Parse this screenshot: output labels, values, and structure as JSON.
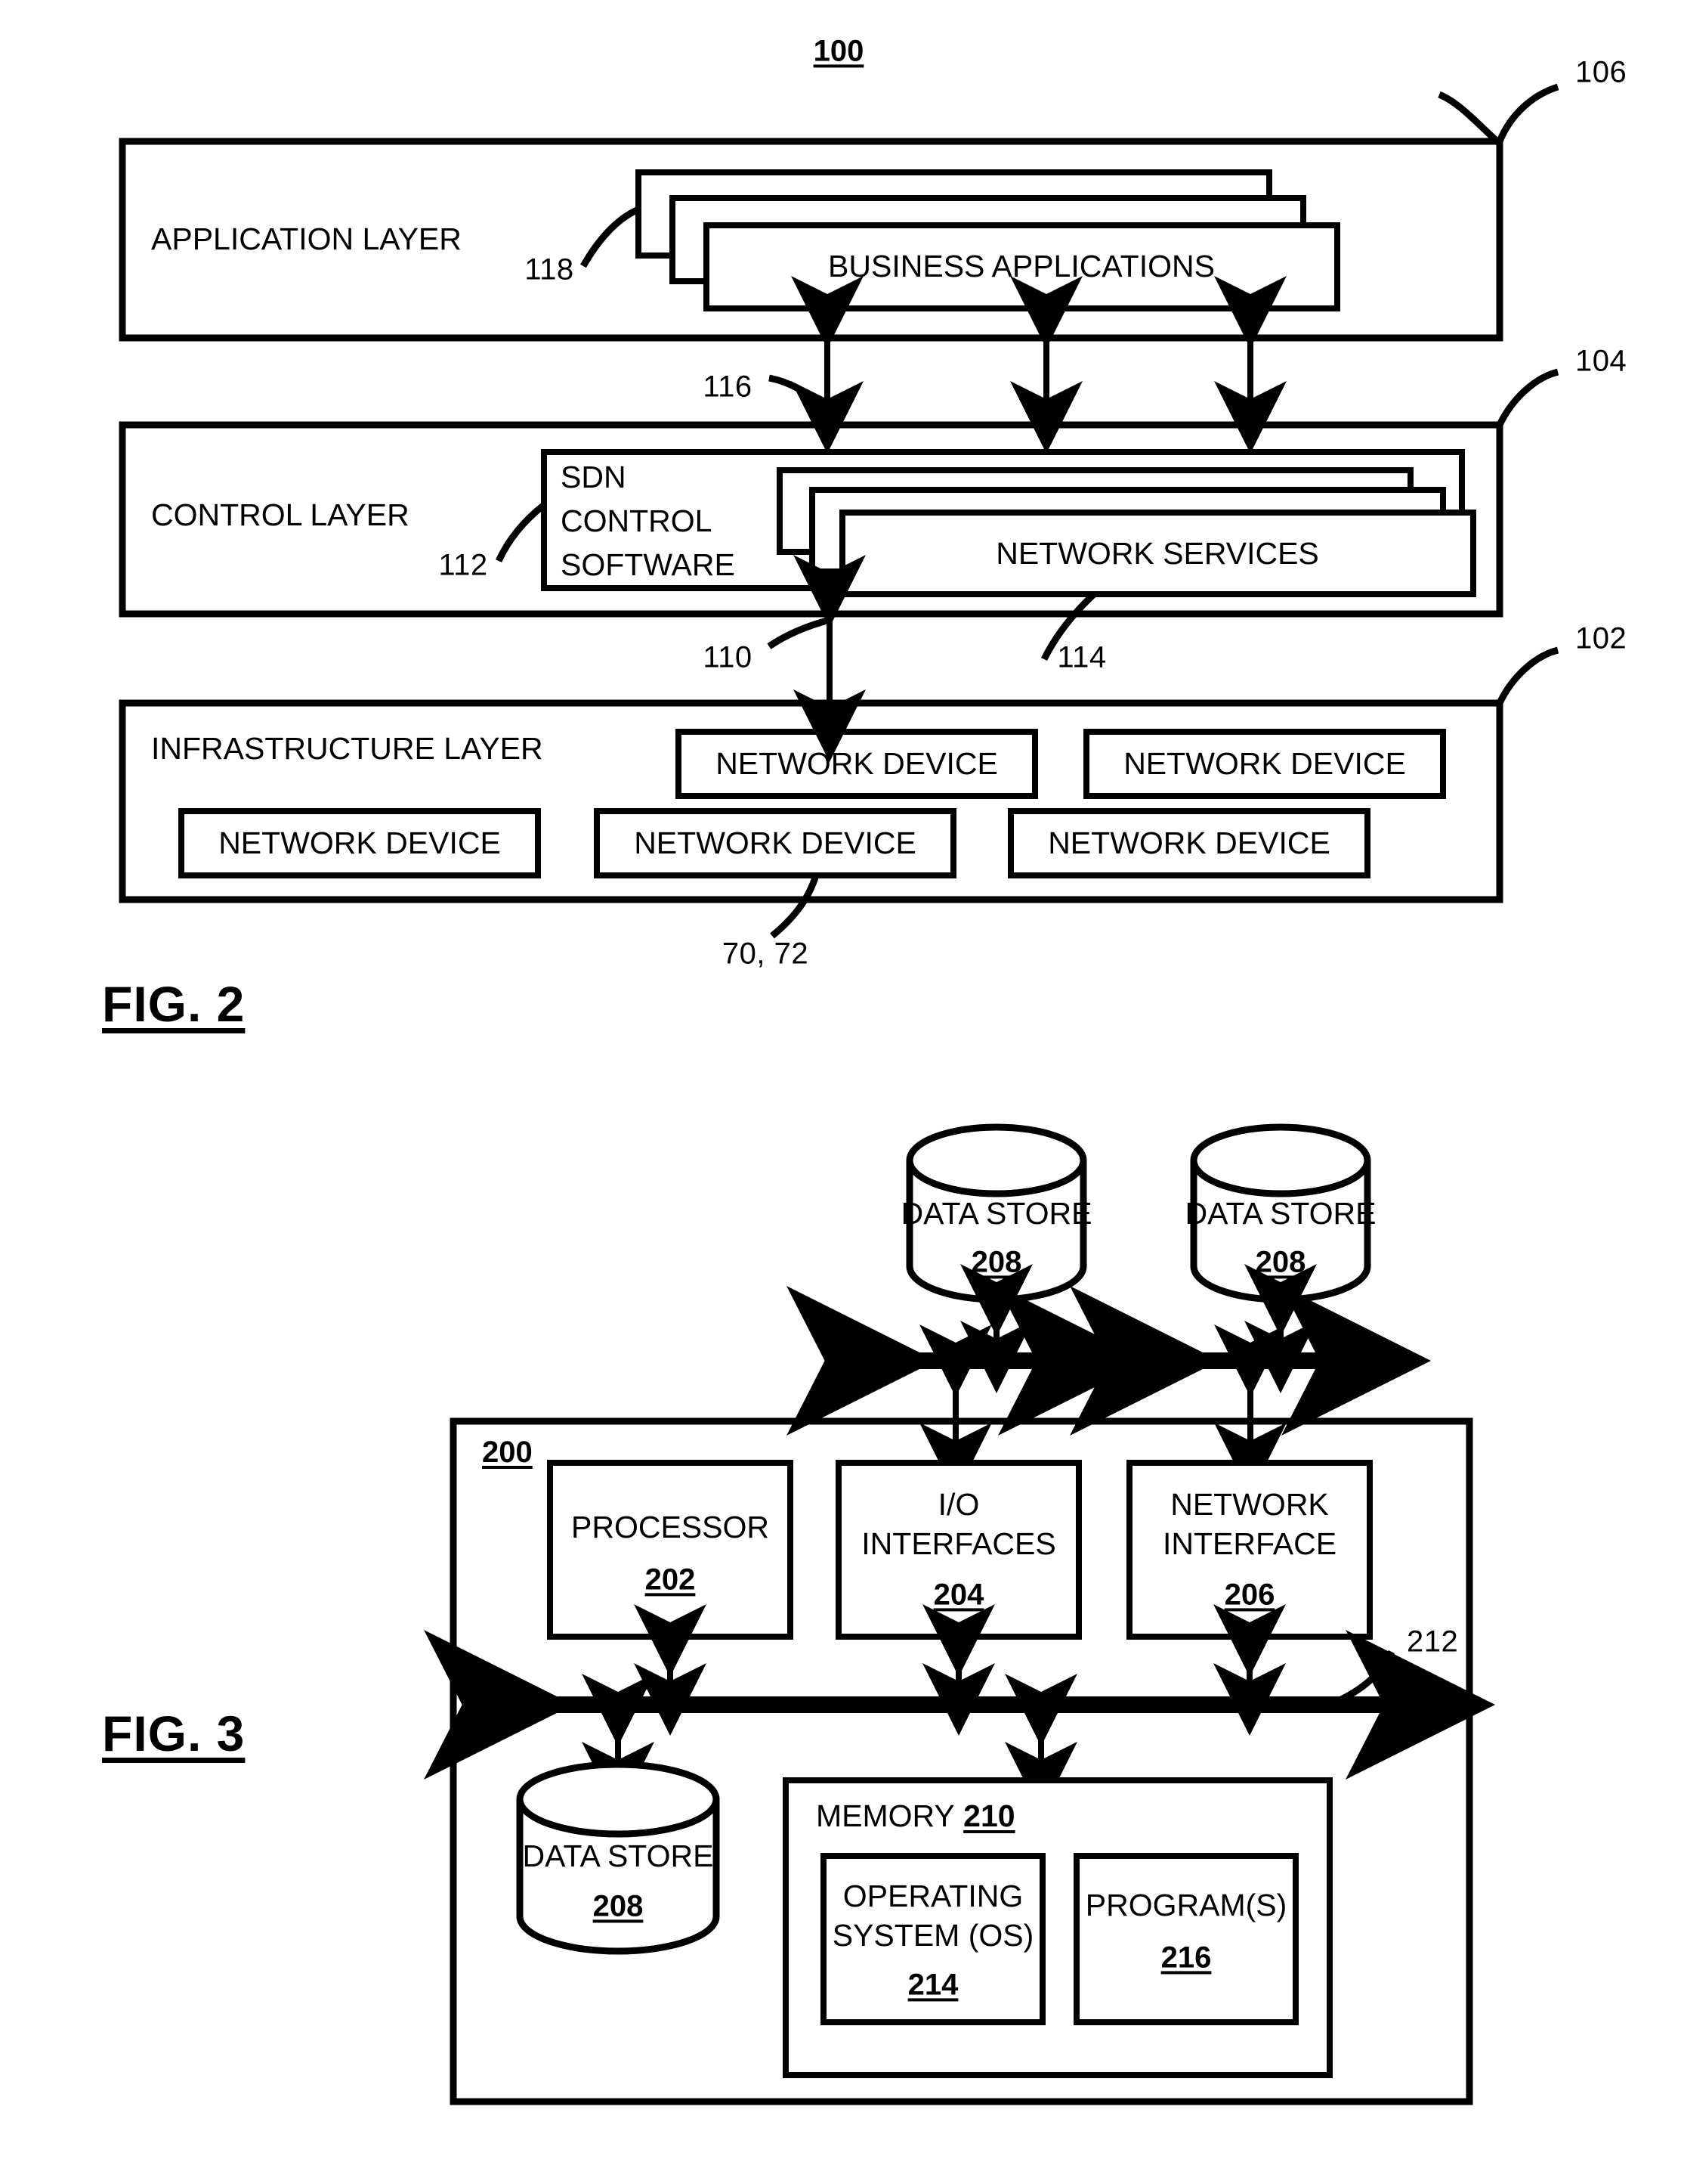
{
  "figures": [
    {
      "id": "fig2",
      "label": "FIG. 2",
      "top_ref": "100",
      "layers": [
        {
          "name": "application-layer",
          "title": "APPLICATION LAYER",
          "ref": "106",
          "stack": {
            "label": "BUSINESS APPLICATIONS",
            "ref": "118",
            "copies": 3
          }
        },
        {
          "name": "control-layer",
          "title": "CONTROL LAYER",
          "ref": "104",
          "software": {
            "line1": "SDN",
            "line2": "CONTROL",
            "line3": "SOFTWARE",
            "ref": "112"
          },
          "stack": {
            "label": "NETWORK SERVICES",
            "ref": "114",
            "copies": 3
          }
        },
        {
          "name": "infrastructure-layer",
          "title": "INFRASTRUCTURE LAYER",
          "ref": "102",
          "devices": [
            "NETWORK DEVICE",
            "NETWORK DEVICE",
            "NETWORK DEVICE",
            "NETWORK DEVICE",
            "NETWORK DEVICE"
          ],
          "device_ref": "70, 72"
        }
      ],
      "interface_refs": {
        "app_to_control": "116",
        "control_to_infra": "110"
      }
    },
    {
      "id": "fig3",
      "label": "FIG. 3",
      "system_ref": "200",
      "bus_ref": "212",
      "top_data_stores": [
        {
          "label": "DATA STORE",
          "ref": "208"
        },
        {
          "label": "DATA STORE",
          "ref": "208"
        }
      ],
      "components": [
        {
          "line1": "PROCESSOR",
          "line2": "",
          "ref": "202"
        },
        {
          "line1": "I/O",
          "line2": "INTERFACES",
          "ref": "204"
        },
        {
          "line1": "NETWORK",
          "line2": "INTERFACE",
          "ref": "206"
        }
      ],
      "bottom_data_store": {
        "label": "DATA STORE",
        "ref": "208"
      },
      "memory": {
        "title": "MEMORY",
        "ref": "210",
        "blocks": [
          {
            "line1": "OPERATING",
            "line2": "SYSTEM (OS)",
            "ref": "214"
          },
          {
            "line1": "PROGRAM(S)",
            "line2": "",
            "ref": "216"
          }
        ]
      }
    }
  ],
  "colors": {
    "ink": "#000000",
    "paper": "#ffffff"
  }
}
